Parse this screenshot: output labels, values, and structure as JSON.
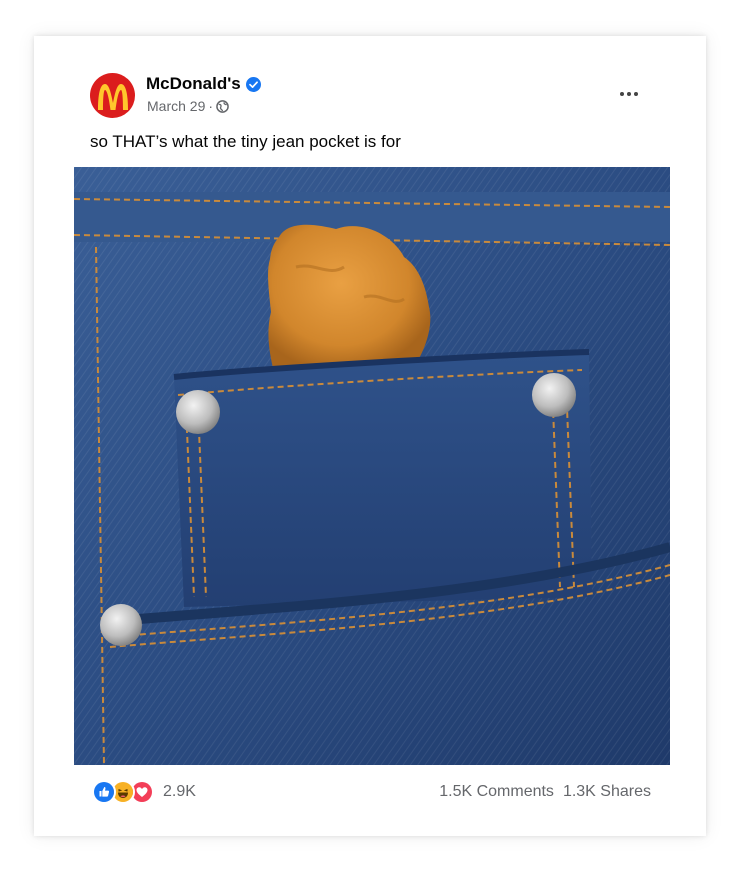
{
  "post": {
    "page_name": "McDonald's",
    "date": "March 29",
    "separator": "·",
    "caption": "so THAT’s what the tiny jean pocket is for",
    "icons": {
      "avatar": "mcdonalds-logo-icon",
      "verified": "verified-badge-icon",
      "audience": "globe-icon",
      "more": "more-options-icon"
    }
  },
  "engagement": {
    "reaction_icons": [
      "like-icon",
      "haha-icon",
      "love-icon"
    ],
    "reaction_count": "2.9K",
    "comments": "1.5K Comments",
    "shares": "1.3K Shares"
  },
  "colors": {
    "brand_red": "#db1d1d",
    "brand_yellow": "#ffc72c",
    "verified_blue": "#1877f2",
    "love_red": "#f33e58",
    "denim": "#2c4f86",
    "nugget": "#d48a2e"
  }
}
